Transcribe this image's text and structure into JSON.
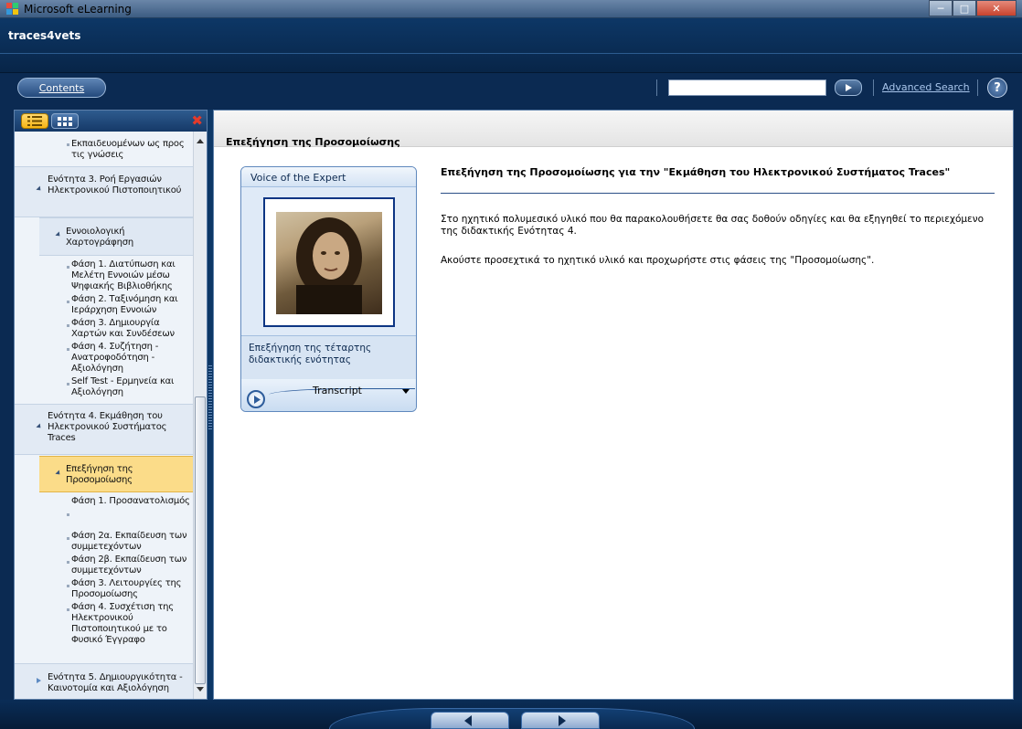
{
  "window": {
    "title": "Microsoft eLearning"
  },
  "header": {
    "course_name": "traces4vets",
    "contents_label": "Contents",
    "search": {
      "value": "",
      "placeholder": ""
    },
    "advanced_search_label": "Advanced Search",
    "help_label": "?"
  },
  "toc": {
    "items": [
      {
        "text": "Εκπαιδευομένων ως προς τις γνώσεις"
      },
      {
        "text": "Ενότητα 3. Ροή Εργασιών Ηλεκτρονικού Πιστοποιητικού"
      },
      {
        "text": "Εννοιολογική Χαρτογράφηση"
      },
      {
        "text": "Φάση 1. Διατύπωση και Μελέτη Εννοιών μέσω Ψηφιακής Βιβλιοθήκης"
      },
      {
        "text": "Φάση 2. Ταξινόμηση και Ιεράρχηση Εννοιών"
      },
      {
        "text": "Φάση 3. Δημιουργία Χαρτών και Συνδέσεων"
      },
      {
        "text": "Φάση 4. Συζήτηση - Ανατροφοδότηση - Αξιολόγηση"
      },
      {
        "text": "Self Test - Ερμηνεία και Αξιολόγηση"
      },
      {
        "text": "Ενότητα 4. Εκμάθηση του Ηλεκτρονικού Συστήματος Traces"
      },
      {
        "text": "Επεξήγηση της Προσομοίωσης"
      },
      {
        "text": "Φάση 1. Προσανατολισμός"
      },
      {
        "text": "Φάση 2α. Εκπαίδευση των συμμετεχόντων"
      },
      {
        "text": "Φάση 2β. Εκπαίδευση των συμμετεχόντων"
      },
      {
        "text": "Φάση 3. Λειτουργίες της Προσομοίωσης"
      },
      {
        "text": "Φάση 4. Συσχέτιση της Ηλεκτρονικού Πιστοποιητικού με το Φυσικό Έγγραφο"
      },
      {
        "text": "Ενότητα 5. Δημιουργικότητα - Καινοτομία και Αξιολόγηση"
      }
    ],
    "selected": "Επεξήγηση της Προσομοίωσης"
  },
  "topic": {
    "header_title": "Επεξήγηση της Προσομοίωσης",
    "voice": {
      "title": "Voice of the Expert",
      "description": "Επεξήγηση της τέταρτης διδακτικής ενότητας",
      "transcript_label": "Transcript"
    },
    "article_title": "Επεξήγηση της Προσομοίωσης για την \"Εκμάθηση του Ηλεκτρονικού Συστήματος Traces\"",
    "paragraphs": [
      "Στο ηχητικό πολυμεσικό υλικό που θα παρακολουθήσετε θα σας δοθούν οδηγίες και θα εξηγηθεί το περιεχόμενο της διδακτικής Ενότητας 4.",
      "Ακούστε προσεχτικά το ηχητικό υλικό και προχωρήστε στις φάσεις της \"Προσομοίωσης\"."
    ]
  },
  "colors": {
    "accent": "#0d3766",
    "selected_item": "#fbdc89",
    "link": "#a9c6ec"
  }
}
